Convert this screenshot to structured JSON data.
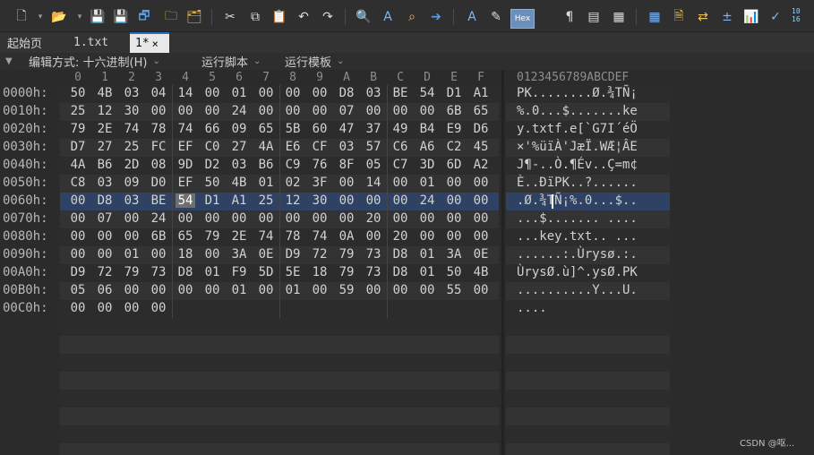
{
  "toolbar": {
    "icons": [
      "new-file-icon",
      "open-folder-icon",
      "save-icon",
      "save-as-icon",
      "save-all-icon",
      "folder-icon",
      "compare-icon",
      "cut-icon",
      "copy-icon",
      "paste-icon",
      "undo-icon",
      "redo-icon",
      "find-icon",
      "find-replace-icon",
      "find-in-files-icon",
      "goto-icon",
      "font-icon",
      "highlight-icon",
      "hex-mode-icon",
      "pilcrow-icon",
      "columns-icon",
      "hex-columns-icon",
      "calculator-icon",
      "report-icon",
      "transform-icon",
      "stats-icon",
      "histogram-icon",
      "checksum-icon",
      "conversion-icon"
    ],
    "hex_label": "Hex",
    "pilcrow": "¶",
    "conv_label_top": "10",
    "conv_label_bottom": "16"
  },
  "tabs": {
    "start_page": "起始页",
    "file1": "1.txt",
    "active": "1*",
    "close": "×"
  },
  "funcbar": {
    "edit_mode": "编辑方式: 十六进制(H)",
    "run_script": "运行脚本",
    "run_template": "运行模板"
  },
  "editor": {
    "column_headers": [
      "0",
      "1",
      "2",
      "3",
      "4",
      "5",
      "6",
      "7",
      "8",
      "9",
      "A",
      "B",
      "C",
      "D",
      "E",
      "F"
    ],
    "ascii_ruler": "0123456789ABCDEF",
    "selected_row": 6,
    "cursor_byte": 4,
    "rows": [
      {
        "offset": "0000h:",
        "bytes": [
          "50",
          "4B",
          "03",
          "04",
          "14",
          "00",
          "01",
          "00",
          "00",
          "00",
          "D8",
          "03",
          "BE",
          "54",
          "D1",
          "A1"
        ],
        "ascii": "PK........Ø.¾TÑ¡"
      },
      {
        "offset": "0010h:",
        "bytes": [
          "25",
          "12",
          "30",
          "00",
          "00",
          "00",
          "24",
          "00",
          "00",
          "00",
          "07",
          "00",
          "00",
          "00",
          "6B",
          "65"
        ],
        "ascii": "%.0...$.......ke"
      },
      {
        "offset": "0020h:",
        "bytes": [
          "79",
          "2E",
          "74",
          "78",
          "74",
          "66",
          "09",
          "65",
          "5B",
          "60",
          "47",
          "37",
          "49",
          "B4",
          "E9",
          "D6"
        ],
        "ascii": "y.txtf.e[`G7I´éÖ"
      },
      {
        "offset": "0030h:",
        "bytes": [
          "D7",
          "27",
          "25",
          "FC",
          "EF",
          "C0",
          "27",
          "4A",
          "E6",
          "CF",
          "03",
          "57",
          "C6",
          "A6",
          "C2",
          "45"
        ],
        "ascii": "×'%üïÀ'JæÏ.WÆ¦ÂE"
      },
      {
        "offset": "0040h:",
        "bytes": [
          "4A",
          "B6",
          "2D",
          "08",
          "9D",
          "D2",
          "03",
          "B6",
          "C9",
          "76",
          "8F",
          "05",
          "C7",
          "3D",
          "6D",
          "A2"
        ],
        "ascii": "J¶-..Ò.¶Év..Ç=m¢"
      },
      {
        "offset": "0050h:",
        "bytes": [
          "C8",
          "03",
          "09",
          "D0",
          "EF",
          "50",
          "4B",
          "01",
          "02",
          "3F",
          "00",
          "14",
          "00",
          "01",
          "00",
          "00"
        ],
        "ascii": "È..ÐïPK..?......"
      },
      {
        "offset": "0060h:",
        "bytes": [
          "00",
          "D8",
          "03",
          "BE",
          "54",
          "D1",
          "A1",
          "25",
          "12",
          "30",
          "00",
          "00",
          "00",
          "24",
          "00",
          "00"
        ],
        "ascii": ".Ø.¾TÑ¡%.0...$.."
      },
      {
        "offset": "0070h:",
        "bytes": [
          "00",
          "07",
          "00",
          "24",
          "00",
          "00",
          "00",
          "00",
          "00",
          "00",
          "00",
          "20",
          "00",
          "00",
          "00",
          "00"
        ],
        "ascii": "...$....... ...."
      },
      {
        "offset": "0080h:",
        "bytes": [
          "00",
          "00",
          "00",
          "6B",
          "65",
          "79",
          "2E",
          "74",
          "78",
          "74",
          "0A",
          "00",
          "20",
          "00",
          "00",
          "00"
        ],
        "ascii": "...key.txt.. ..."
      },
      {
        "offset": "0090h:",
        "bytes": [
          "00",
          "00",
          "01",
          "00",
          "18",
          "00",
          "3A",
          "0E",
          "D9",
          "72",
          "79",
          "73",
          "D8",
          "01",
          "3A",
          "0E"
        ],
        "ascii": "......:.Ùrysø.:."
      },
      {
        "offset": "00A0h:",
        "bytes": [
          "D9",
          "72",
          "79",
          "73",
          "D8",
          "01",
          "F9",
          "5D",
          "5E",
          "18",
          "79",
          "73",
          "D8",
          "01",
          "50",
          "4B"
        ],
        "ascii": "ÙrysØ.ù]^.ysØ.PK"
      },
      {
        "offset": "00B0h:",
        "bytes": [
          "05",
          "06",
          "00",
          "00",
          "00",
          "00",
          "01",
          "00",
          "01",
          "00",
          "59",
          "00",
          "00",
          "00",
          "55",
          "00"
        ],
        "ascii": "..........Y...U."
      },
      {
        "offset": "00C0h:",
        "bytes": [
          "00",
          "00",
          "00",
          "00"
        ],
        "ascii": "...."
      }
    ]
  },
  "watermark": "CSDN @呕..."
}
